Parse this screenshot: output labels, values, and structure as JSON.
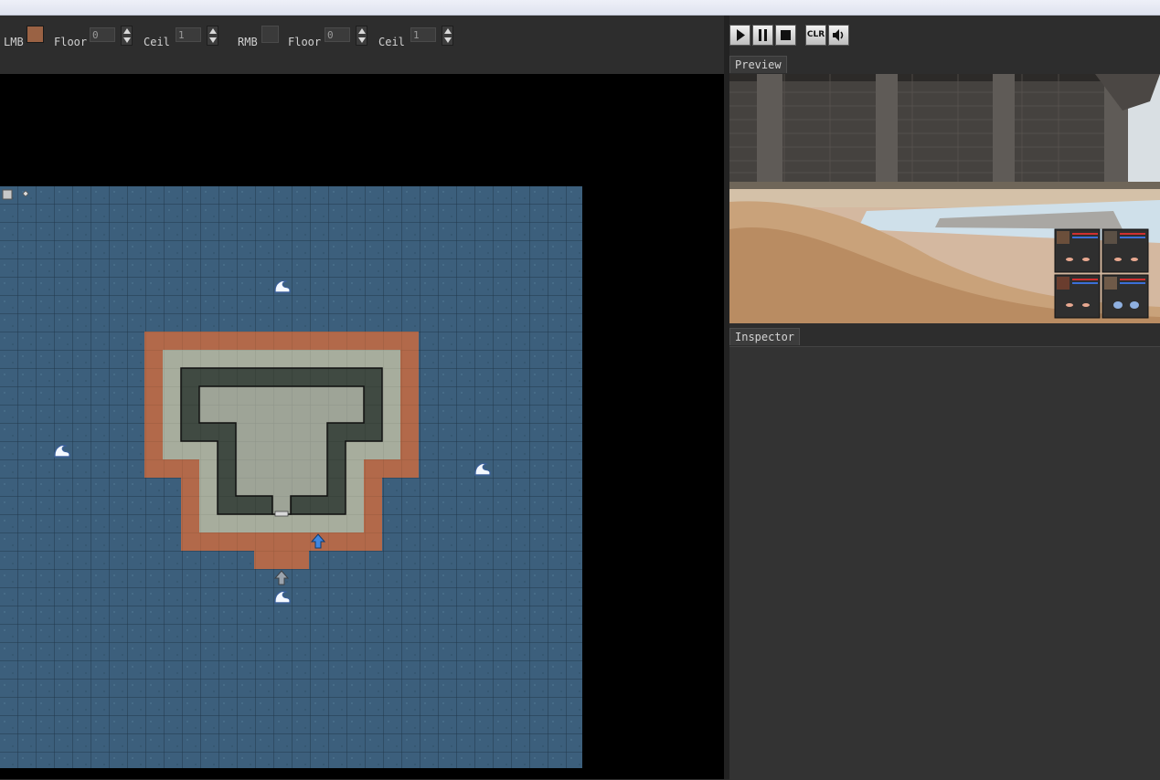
{
  "toolbar": {
    "lmb_label": "LMB",
    "rmb_label": "RMB",
    "lmb": {
      "floor_label": "Floor",
      "floor_value": "0",
      "ceil_label": "Ceil",
      "ceil_value": "1",
      "swatch_color": "#9a6244"
    },
    "rmb": {
      "floor_label": "Floor",
      "floor_value": "0",
      "ceil_label": "Ceil",
      "ceil_value": "1",
      "swatch_color": "#3a3a3a"
    }
  },
  "playback": {
    "buttons": [
      {
        "name": "play-icon"
      },
      {
        "name": "pause-icon"
      },
      {
        "name": "stop-icon"
      },
      {
        "name": "clear-button",
        "label": "CLR"
      },
      {
        "name": "speaker-icon"
      }
    ]
  },
  "panels": {
    "preview_tab": "Preview",
    "inspector_tab": "Inspector"
  },
  "map": {
    "water_color": "#3c5f7c",
    "grid_color": "#22384c",
    "sand_color": "#b2694a",
    "path_color": "#a7ad9d",
    "wall_color": "#3f4a41",
    "markers": [
      "wave-icon",
      "wave-icon",
      "wave-icon",
      "wave-icon",
      "blue-arrow-icon",
      "grey-arrow-icon"
    ]
  }
}
